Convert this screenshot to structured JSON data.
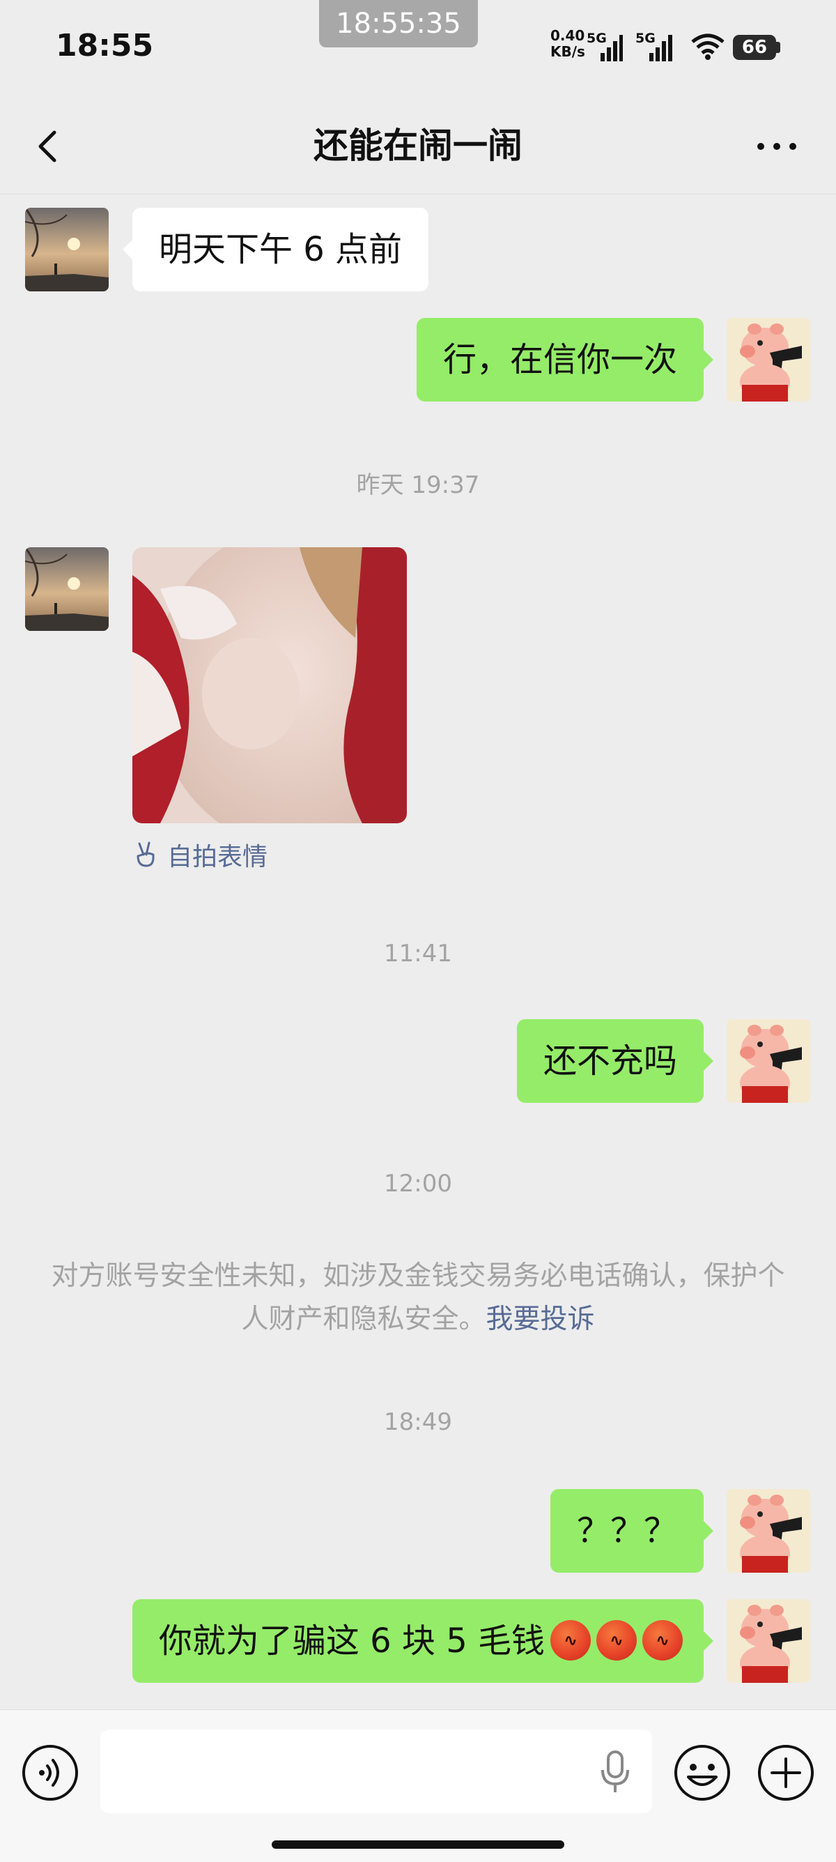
{
  "status_bar": {
    "time": "18:55",
    "clock_overlay": "18:55:35",
    "net_speed_value": "0.40",
    "net_speed_unit": "KB/s",
    "signal_1_label": "5G",
    "signal_2_label": "5G",
    "battery": "66"
  },
  "nav": {
    "title": "还能在闹一闹"
  },
  "messages": {
    "m1": "明天下午 6 点前",
    "m2": "行，在信你一次",
    "ts1": "昨天 19:37",
    "selfie_tag": "自拍表情",
    "ts2": "11:41",
    "m3": "还不充吗",
    "ts3": "12:00",
    "notice": "对方账号安全性未知，如涉及金钱交易务必电话确认，保护个人财产和隐私安全。",
    "report_link": "我要投诉",
    "ts4": "18:49",
    "m4": "？？？",
    "m5": "你就为了骗这 6 块 5 毛钱"
  },
  "icons": {
    "back": "chevron-left-icon",
    "more": "more-dots-icon",
    "voice": "voice-icon",
    "mic": "mic-icon",
    "emoji": "emoji-icon",
    "add": "plus-icon",
    "angry": "angry-face-emoji"
  },
  "colors": {
    "background": "#ededed",
    "bubble_out": "#95ec69",
    "bubble_in": "#ffffff",
    "link": "#576b95",
    "timestamp": "#a3a3a3"
  }
}
